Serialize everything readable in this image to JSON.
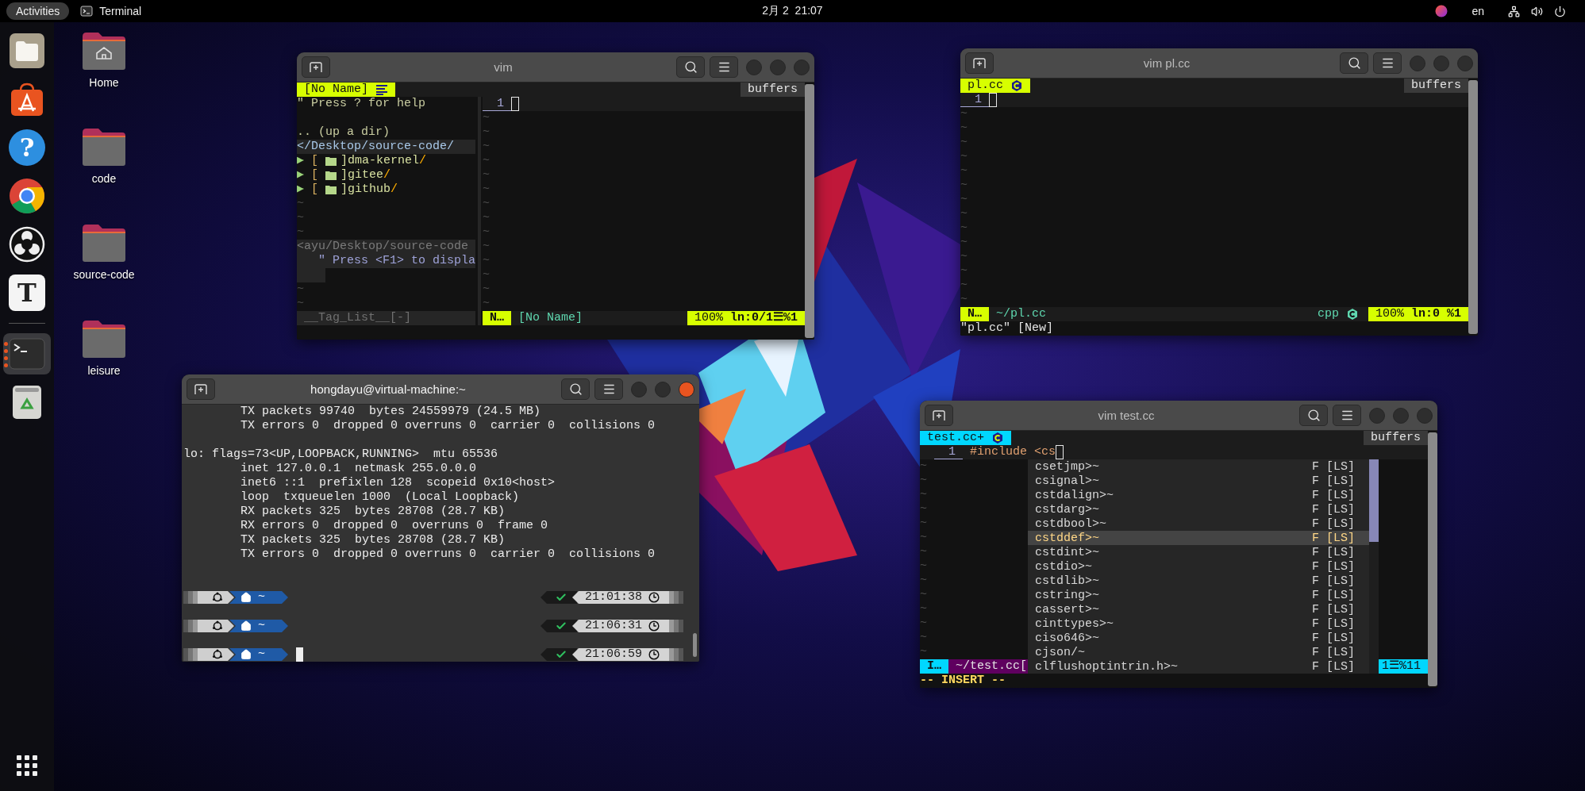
{
  "top_bar": {
    "activities": "Activities",
    "app_name": "Terminal",
    "clock": "2月 2  21:07",
    "language": "en"
  },
  "dock": {
    "apps": [
      {
        "kind": "files",
        "selected": false
      },
      {
        "kind": "store",
        "selected": false
      },
      {
        "kind": "help",
        "glyph": "?",
        "selected": false
      },
      {
        "kind": "chrome",
        "selected": false
      },
      {
        "kind": "obs",
        "selected": false
      },
      {
        "kind": "text",
        "glyph": "T",
        "selected": false
      },
      {
        "kind": "terminal",
        "selected": true
      },
      {
        "kind": "trash",
        "selected": false
      }
    ]
  },
  "desktop_icons": [
    {
      "kind": "home",
      "label": "Home"
    },
    {
      "kind": "folder",
      "label": "code"
    },
    {
      "kind": "folder",
      "label": "source-code"
    },
    {
      "kind": "folder",
      "label": "leisure"
    }
  ],
  "windows": [
    {
      "kind": "vim",
      "title": "vim",
      "focused": false,
      "tabline": {
        "label": "[No Name]",
        "kind": "plain",
        "buffers": "buffers"
      },
      "sidebar": {
        "help": "\" Press ? for help",
        "updir": ".. (up a dir)",
        "root": "</Desktop/source-code/",
        "tree": [
          {
            "marker": "▶",
            "open": "[",
            "close": "]",
            "name": "dma-kernel",
            "suffix": "/"
          },
          {
            "marker": "▶",
            "open": "[",
            "close": "]",
            "name": "gitee",
            "suffix": "/"
          },
          {
            "marker": "▶",
            "open": "[",
            "close": "]",
            "name": "github",
            "suffix": "/"
          }
        ],
        "tree_filler": [
          "~",
          "~",
          "~"
        ],
        "tree_status": "<ayu/Desktop/source-code",
        "taglist_hint": "\" Press <F1> to displa",
        "taglist_filler": [
          "~",
          "~"
        ],
        "taglist_status": "__Tag_List__[-]"
      },
      "lines": [
        {
          "number": "1",
          "cursor": true
        }
      ],
      "filler": [
        "~",
        "~",
        "~",
        "~",
        "~",
        "~",
        "~",
        "~",
        "~",
        "~",
        "~",
        "~",
        "~",
        "~"
      ],
      "statusline": {
        "kind": "normal",
        "mode": "N…",
        "file": "[No Name]",
        "position": "100% **ln:0/1☰%1**"
      }
    },
    {
      "kind": "vim",
      "title": "vim pl.cc",
      "focused": false,
      "tabline": {
        "label": "pl.cc",
        "kind": "cpp",
        "buffers": "buffers"
      },
      "lines": [
        {
          "number": "1",
          "cursor": true
        }
      ],
      "filler": [
        "~",
        "~",
        "~",
        "~",
        "~",
        "~",
        "~",
        "~",
        "~",
        "~",
        "~",
        "~",
        "~",
        "~"
      ],
      "statusline": {
        "kind": "normal",
        "mode": "N…",
        "file": "~/pl.cc",
        "filetype": "cpp",
        "position": "100% **ln:0 %1**"
      },
      "cmdline": "\"pl.cc\" [New]"
    },
    {
      "kind": "terminal",
      "title": "hongdayu@virtual-machine:~",
      "focused": true,
      "output": [
        [
          "        TX packets 99740  bytes 24559979 (24.5 MB)",
          "        TX errors 0  dropped 0 overruns 0  carrier 0  collisions 0"
        ],
        [
          "lo: flags=73<UP,LOOPBACK,RUNNING>  mtu 65536",
          "        inet 127.0.0.1  netmask 255.0.0.0",
          "        inet6 ::1  prefixlen 128  scopeid 0x10<host>",
          "        loop  txqueuelen 1000  (Local Loopback)",
          "        RX packets 325  bytes 28708 (28.7 KB)",
          "        RX errors 0  dropped 0  overruns 0  frame 0",
          "        TX packets 325  bytes 28708 (28.7 KB)",
          "        TX errors 0  dropped 0 overruns 0  carrier 0  collisions 0"
        ]
      ],
      "prompts": [
        {
          "path": "~",
          "time": "21:01:38",
          "cursor": false
        },
        {
          "path": "~",
          "time": "21:06:31",
          "cursor": false
        },
        {
          "path": "~",
          "time": "21:06:59",
          "cursor": true
        }
      ]
    },
    {
      "kind": "vim",
      "title": "vim test.cc",
      "focused": false,
      "tabline": {
        "label": "test.cc+",
        "kind": "cpp",
        "buffers": "buffers"
      },
      "lines": [
        {
          "number": "1",
          "text": "#include <cs",
          "cursor": true
        }
      ],
      "filler": [
        "~",
        "~",
        "~",
        "~",
        "~",
        "~",
        "~",
        "~",
        "~",
        "~",
        "~",
        "~",
        "~",
        "~"
      ],
      "statusline": {
        "kind": "insert",
        "mode": "I…",
        "file": "~/test.cc[",
        "position": "1☰%11"
      },
      "completion": {
        "items": [
          {
            "label": "csetjmp>~",
            "type": "F",
            "source": "[LS]",
            "selected": false
          },
          {
            "label": "csignal>~",
            "type": "F",
            "source": "[LS]",
            "selected": false
          },
          {
            "label": "cstdalign>~",
            "type": "F",
            "source": "[LS]",
            "selected": false
          },
          {
            "label": "cstdarg>~",
            "type": "F",
            "source": "[LS]",
            "selected": false
          },
          {
            "label": "cstdbool>~",
            "type": "F",
            "source": "[LS]",
            "selected": false
          },
          {
            "label": "cstddef>~",
            "type": "F",
            "source": "[LS]",
            "selected": true
          },
          {
            "label": "cstdint>~",
            "type": "F",
            "source": "[LS]",
            "selected": false
          },
          {
            "label": "cstdio>~",
            "type": "F",
            "source": "[LS]",
            "selected": false
          },
          {
            "label": "cstdlib>~",
            "type": "F",
            "source": "[LS]",
            "selected": false
          },
          {
            "label": "cstring>~",
            "type": "F",
            "source": "[LS]",
            "selected": false
          },
          {
            "label": "cassert>~",
            "type": "F",
            "source": "[LS]",
            "selected": false
          },
          {
            "label": "cinttypes>~",
            "type": "F",
            "source": "[LS]",
            "selected": false
          },
          {
            "label": "ciso646>~",
            "type": "F",
            "source": "[LS]",
            "selected": false
          },
          {
            "label": "cjson/~",
            "type": "F",
            "source": "[LS]",
            "selected": false
          },
          {
            "label": "clflushoptintrin.h>~",
            "type": "F",
            "source": "[LS]",
            "selected": false
          }
        ]
      },
      "cmdline": "-- INSERT --"
    }
  ]
}
